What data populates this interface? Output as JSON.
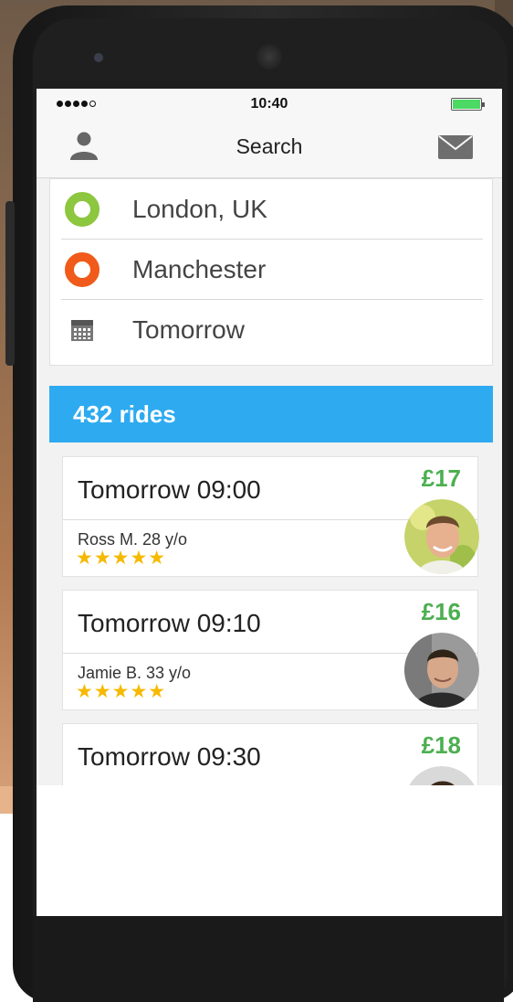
{
  "status_bar": {
    "time": "10:40",
    "signal_bars": 4,
    "battery_color": "#4cd964"
  },
  "nav": {
    "title": "Search",
    "left_icon": "user-icon",
    "right_icon": "mail-icon"
  },
  "search": {
    "from": "London, UK",
    "to": "Manchester",
    "date": "Tomorrow",
    "from_color": "#8dc63f",
    "to_color": "#f05a1a"
  },
  "results": {
    "count_label": "432 rides",
    "header_color": "#2eaaf0"
  },
  "rides": [
    {
      "time": "Tomorrow 09:00",
      "price": "£17",
      "driver": "Ross M. 28 y/o",
      "stars": "★★★★★"
    },
    {
      "time": "Tomorrow 09:10",
      "price": "£16",
      "driver": "Jamie B. 33 y/o",
      "stars": "★★★★★"
    },
    {
      "time": "Tomorrow 09:30",
      "price": "£18"
    }
  ],
  "colors": {
    "price": "#4caf50",
    "star": "#f6b900"
  }
}
